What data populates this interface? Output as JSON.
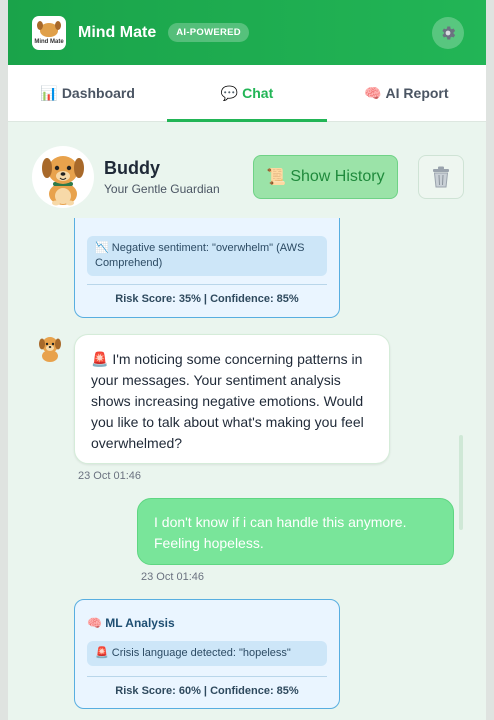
{
  "header": {
    "app_title": "Mind Mate",
    "badge": "AI-POWERED",
    "logo_text": "Mind Mate"
  },
  "tabs": [
    {
      "icon": "📊",
      "label": "Dashboard"
    },
    {
      "icon": "💬",
      "label": "Chat"
    },
    {
      "icon": "🧠",
      "label": "AI Report"
    }
  ],
  "companion": {
    "name": "Buddy",
    "subtitle": "Your Gentle Guardian",
    "history_icon": "📜",
    "history_label": "Show History",
    "trash_icon": "🗑️"
  },
  "messages": {
    "ml_top": {
      "detect_icon": "📉",
      "detection": "Negative sentiment: \"overwhelm\" (AWS Comprehend)",
      "risk": "Risk Score: 35% | Confidence: 85%"
    },
    "bot": {
      "text": "🚨 I'm noticing some concerning patterns in your messages. Your sentiment analysis shows increasing negative emotions. Would you like to talk about what's making you feel overwhelmed?",
      "time": "23 Oct 01:46"
    },
    "user": {
      "text": "I don't know if i can handle this anymore. Feeling hopeless.",
      "time": "23 Oct 01:46"
    },
    "ml_bottom": {
      "title": "🧠 ML Analysis",
      "detection": "🚨 Crisis language detected: \"hopeless\"",
      "risk": "Risk Score: 60% | Confidence: 85%"
    }
  },
  "colors": {
    "primary": "#22b556",
    "ml_border": "#58aee0",
    "user_bubble": "#79e59a"
  }
}
